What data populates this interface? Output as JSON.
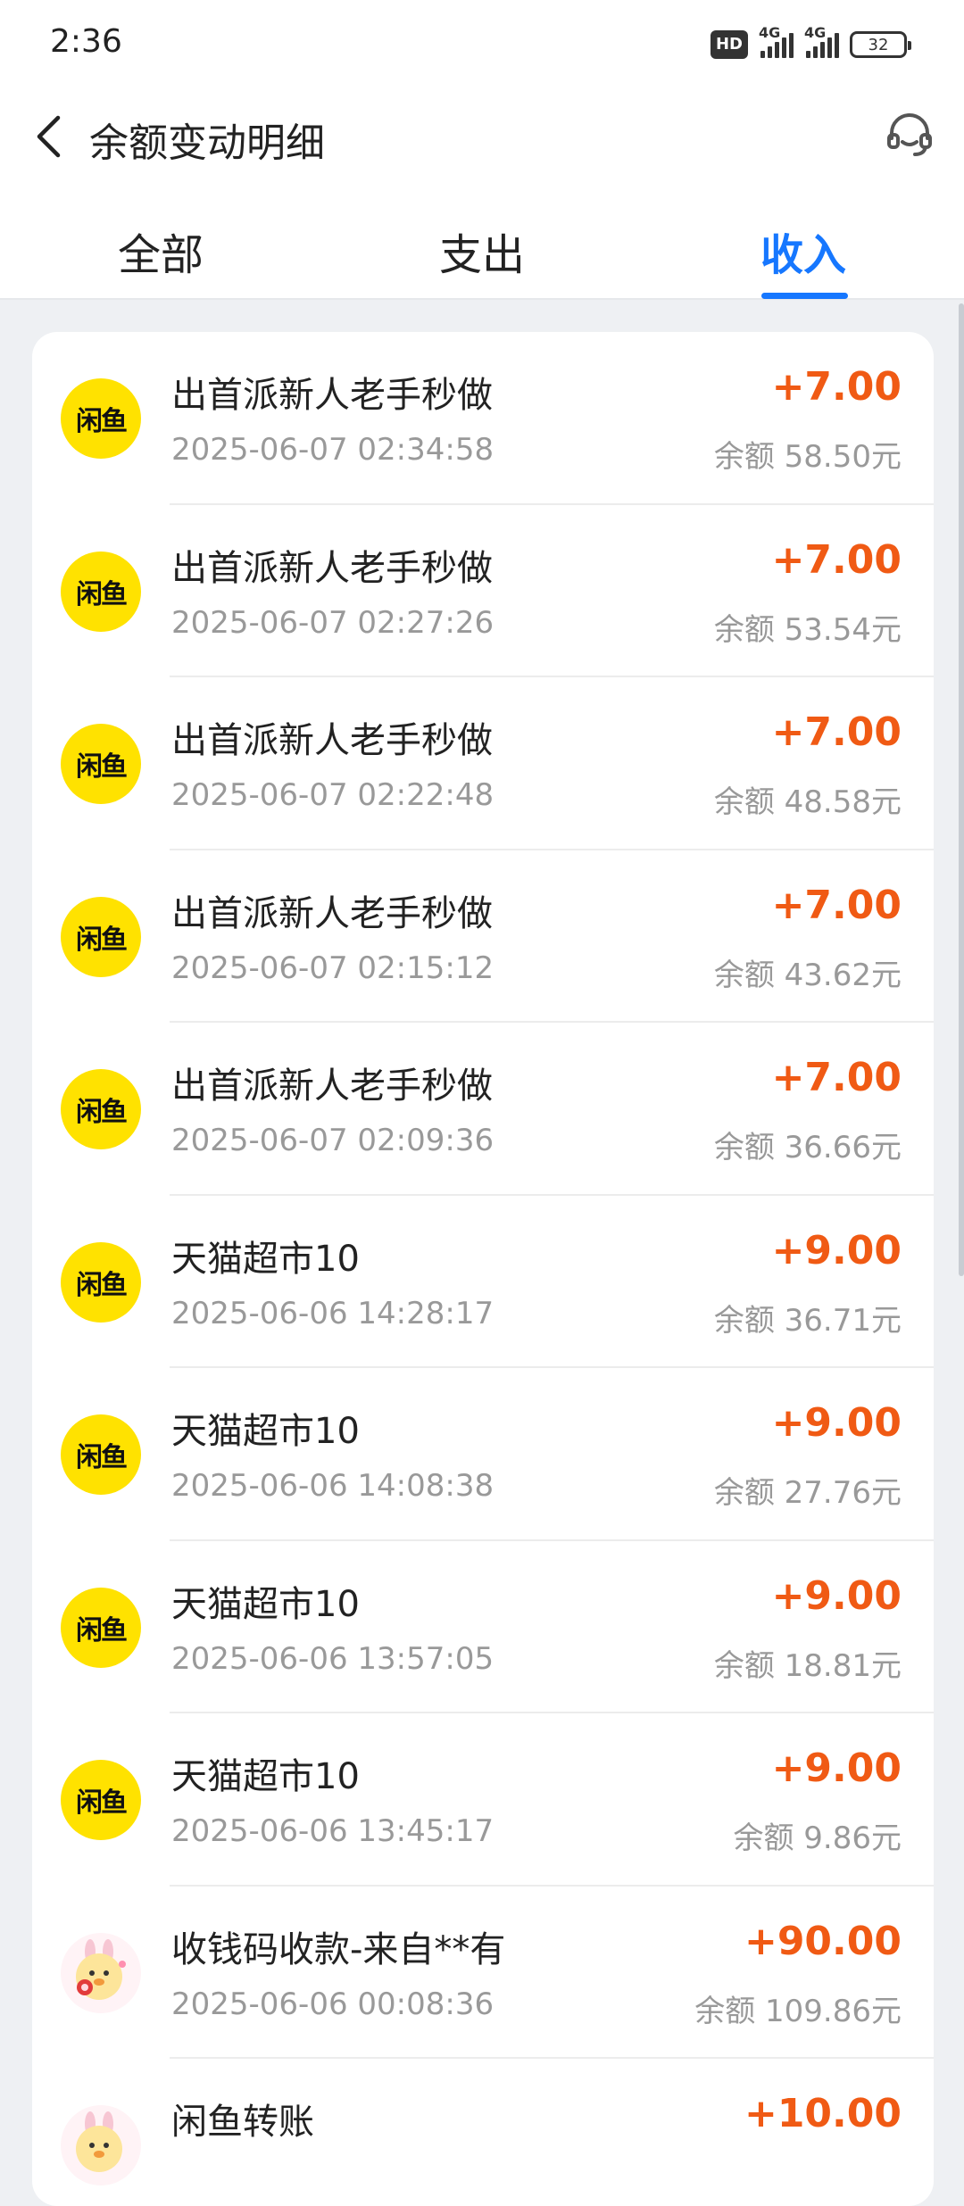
{
  "status_bar": {
    "time": "2:36",
    "hd_label": "HD",
    "network_1": "4G",
    "network_2": "4G",
    "battery": "32"
  },
  "header": {
    "title": "余额变动明细",
    "back_icon": "chevron-left-icon",
    "support_icon": "headset-icon"
  },
  "tabs": [
    {
      "label": "全部",
      "active": false
    },
    {
      "label": "支出",
      "active": false
    },
    {
      "label": "收入",
      "active": true
    }
  ],
  "colors": {
    "accent": "#1677ff",
    "amount": "#f05a14",
    "avatar_yellow": "#ffe200"
  },
  "transactions": [
    {
      "avatar": "闲鱼",
      "title": "出首派新人老手秒做",
      "time": "2025-06-07 02:34:58",
      "amount": "+7.00",
      "balance": "余额 58.50元"
    },
    {
      "avatar": "闲鱼",
      "title": "出首派新人老手秒做",
      "time": "2025-06-07 02:27:26",
      "amount": "+7.00",
      "balance": "余额 53.54元"
    },
    {
      "avatar": "闲鱼",
      "title": "出首派新人老手秒做",
      "time": "2025-06-07 02:22:48",
      "amount": "+7.00",
      "balance": "余额 48.58元"
    },
    {
      "avatar": "闲鱼",
      "title": "出首派新人老手秒做",
      "time": "2025-06-07 02:15:12",
      "amount": "+7.00",
      "balance": "余额 43.62元"
    },
    {
      "avatar": "闲鱼",
      "title": "出首派新人老手秒做",
      "time": "2025-06-07 02:09:36",
      "amount": "+7.00",
      "balance": "余额 36.66元"
    },
    {
      "avatar": "闲鱼",
      "title": "天猫超市10",
      "time": "2025-06-06 14:28:17",
      "amount": "+9.00",
      "balance": "余额 36.71元"
    },
    {
      "avatar": "闲鱼",
      "title": "天猫超市10",
      "time": "2025-06-06 14:08:38",
      "amount": "+9.00",
      "balance": "余额 27.76元"
    },
    {
      "avatar": "闲鱼",
      "title": "天猫超市10",
      "time": "2025-06-06 13:57:05",
      "amount": "+9.00",
      "balance": "余额 18.81元"
    },
    {
      "avatar": "闲鱼",
      "title": "天猫超市10",
      "time": "2025-06-06 13:45:17",
      "amount": "+9.00",
      "balance": "余额 9.86元"
    },
    {
      "avatar": "sticker",
      "title": "收钱码收款-来自**有",
      "time": "2025-06-06 00:08:36",
      "amount": "+90.00",
      "balance": "余额 109.86元"
    },
    {
      "avatar": "sticker",
      "title": "闲鱼转账",
      "time": "",
      "amount": "+10.00",
      "balance": ""
    }
  ]
}
